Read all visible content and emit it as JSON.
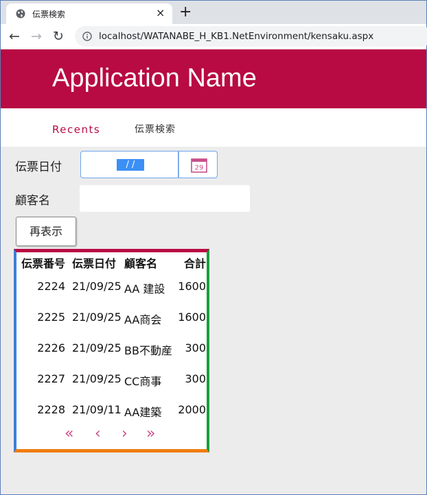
{
  "browser": {
    "tab_title": "伝票検索",
    "tab_close": "×",
    "new_tab": "+",
    "back": "←",
    "forward": "→",
    "reload": "↻",
    "url": "localhost/WATANABE_H_KB1.NetEnvironment/kensaku.aspx"
  },
  "app": {
    "name": "Application Name",
    "nav": {
      "recents": "Recents",
      "search": "伝票検索"
    }
  },
  "form": {
    "date_label": "伝票日付",
    "date_value": " / / ",
    "calendar_day": "29",
    "customer_label": "顧客名",
    "customer_value": "",
    "refresh_button": "再表示"
  },
  "grid": {
    "headers": [
      "伝票番号",
      "伝票日付",
      "顧客名",
      "合計"
    ],
    "rows": [
      [
        "2224",
        "21/09/25",
        "AA 建設",
        "1600"
      ],
      [
        "2225",
        "21/09/25",
        "AA商会",
        "1600"
      ],
      [
        "2226",
        "21/09/25",
        "BB不動産",
        "300"
      ],
      [
        "2227",
        "21/09/25",
        "CC商事",
        "300"
      ],
      [
        "2228",
        "21/09/11",
        "AA建築",
        "2000"
      ]
    ],
    "pager": {
      "first": "«",
      "prev": "‹",
      "next": "›",
      "last": "»"
    }
  },
  "colors": {
    "brand": "#b80a43",
    "grid_left": "#3b7fd9",
    "grid_right": "#17a03c",
    "grid_bottom": "#f07d10",
    "pager": "#c8508a"
  },
  "icons": [
    "globe-icon",
    "info-icon",
    "calendar-icon"
  ]
}
